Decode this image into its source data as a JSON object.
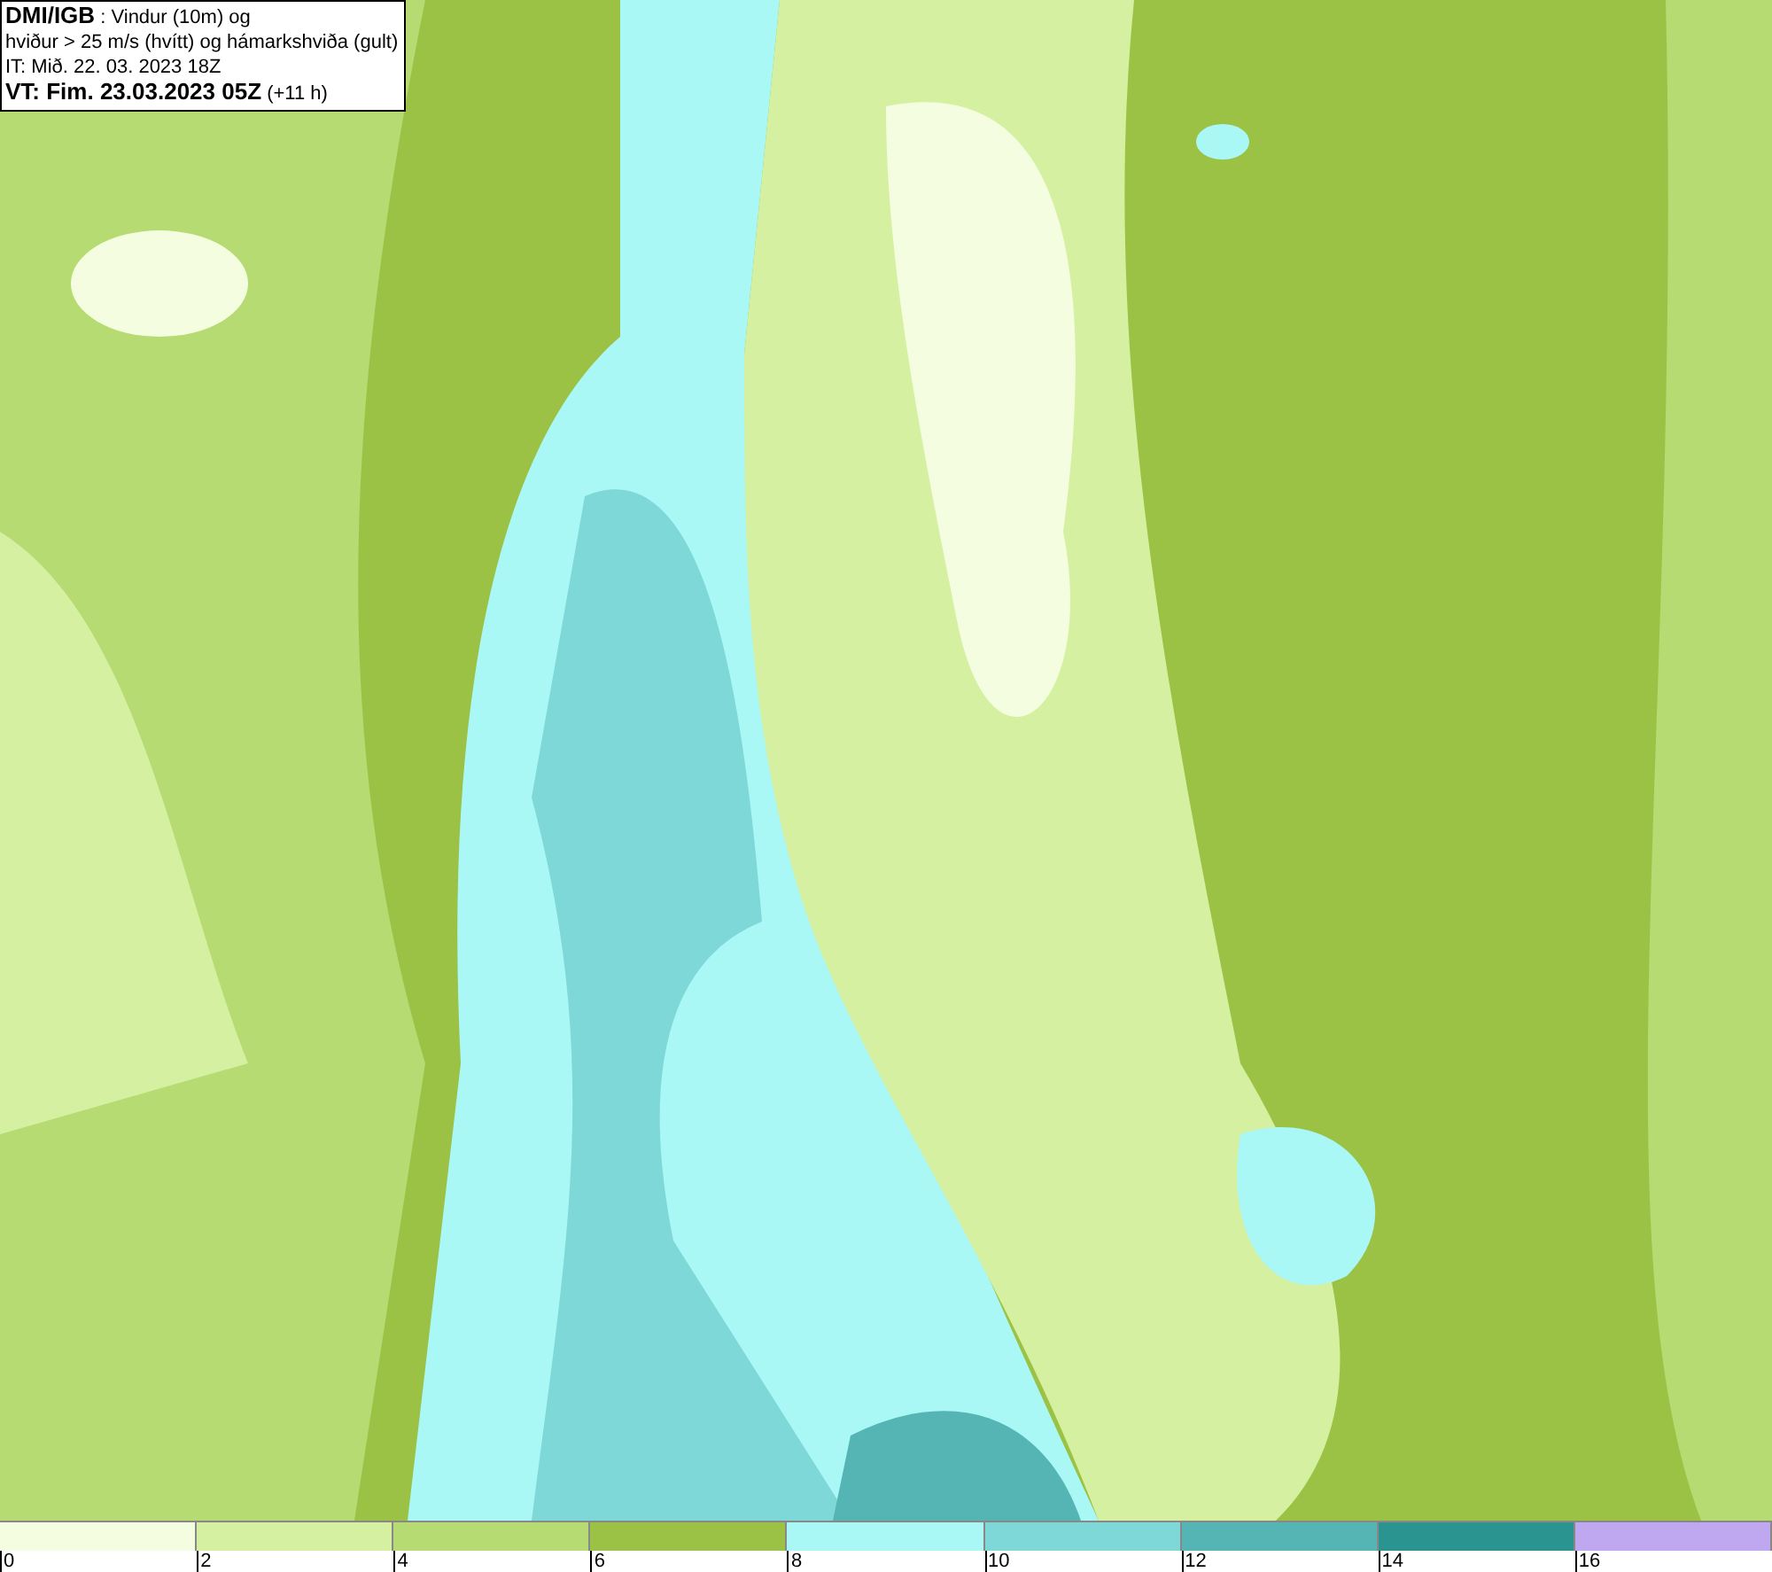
{
  "title_box": {
    "lines": [
      "**DMI/IGB** : Vindur (10m) og",
      "hviður > 25 m/s (hvítt) og hámarkshviða (gult)",
      "IT: Mið. 22. 03. 2023 18Z",
      "**VT: Fim. 23.03.2023 05Z** (+11 h)"
    ]
  },
  "legend": [
    {
      "color": "#f5fde0",
      "label": "0"
    },
    {
      "color": "#d4f0a0",
      "label": "2"
    },
    {
      "color": "#b5db72",
      "label": "4"
    },
    {
      "color": "#9bc244",
      "label": "6"
    },
    {
      "color": "#aaf8f6",
      "label": "8"
    },
    {
      "color": "#7fd8d8",
      "label": "10"
    },
    {
      "color": "#55b5b5",
      "label": "12"
    },
    {
      "color": "#2a9590",
      "label": "14"
    },
    {
      "color": "#c0a8f0",
      "label": "16"
    }
  ]
}
